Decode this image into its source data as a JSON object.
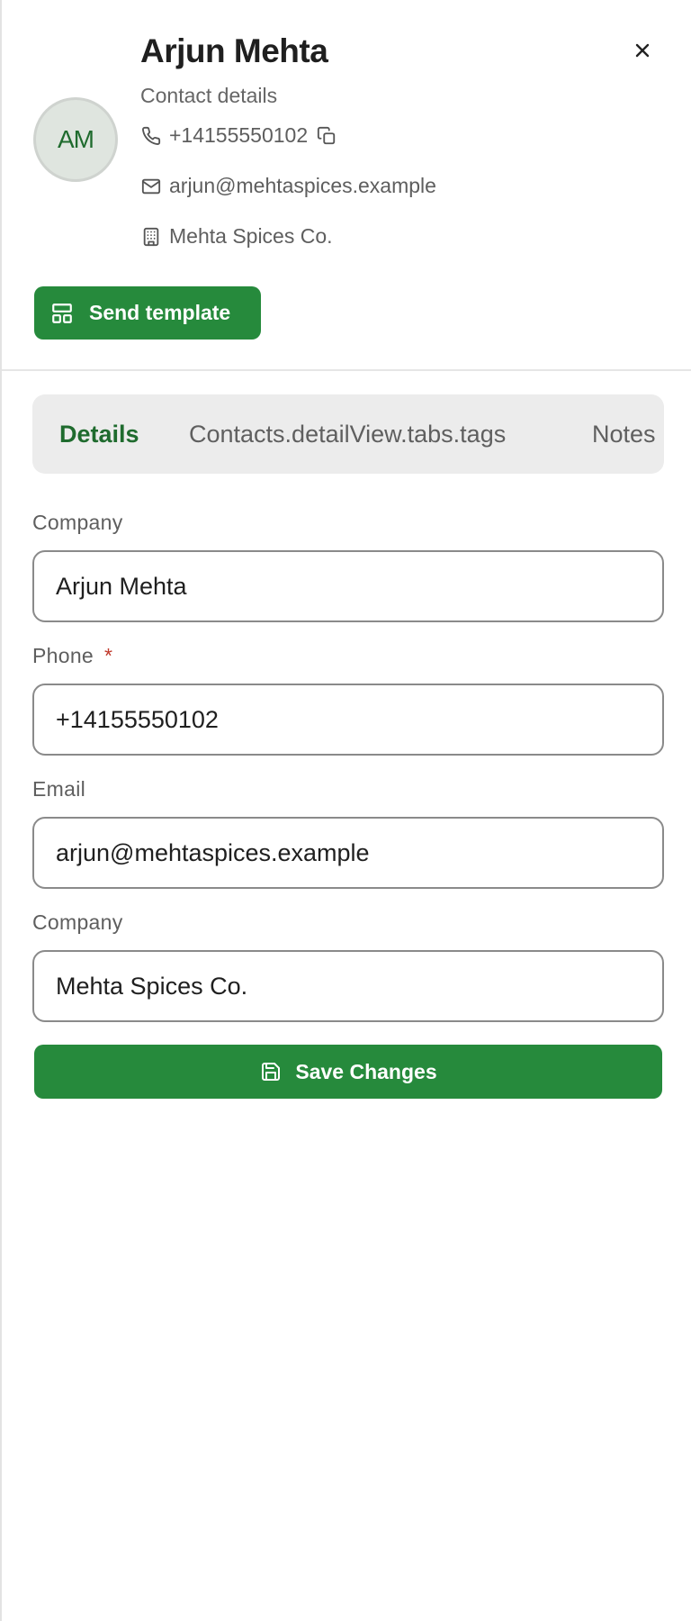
{
  "contact": {
    "initials": "AM",
    "name": "Arjun Mehta",
    "subtitle": "Contact details",
    "phone": "+14155550102",
    "email": "arjun@mehtaspices.example",
    "company": "Mehta Spices Co."
  },
  "header": {
    "close_icon": "close-icon",
    "send_template_label": "Send template"
  },
  "tabs": [
    {
      "label": "Details",
      "active": true
    },
    {
      "label": "Contacts.detailView.tabs.tags",
      "active": false
    },
    {
      "label": "Notes",
      "active": false
    }
  ],
  "form": {
    "fields": [
      {
        "label": "Company",
        "value": "Arjun Mehta",
        "required": false
      },
      {
        "label": "Phone",
        "value": "+14155550102",
        "required": true
      },
      {
        "label": "Email",
        "value": "arjun@mehtaspices.example",
        "required": false
      },
      {
        "label": "Company",
        "value": "Mehta Spices Co.",
        "required": false
      }
    ],
    "required_marker": "*",
    "save_label": "Save Changes"
  },
  "colors": {
    "accent": "#268a3c",
    "accent_text": "#1f6b2e",
    "required": "#c0392b"
  }
}
